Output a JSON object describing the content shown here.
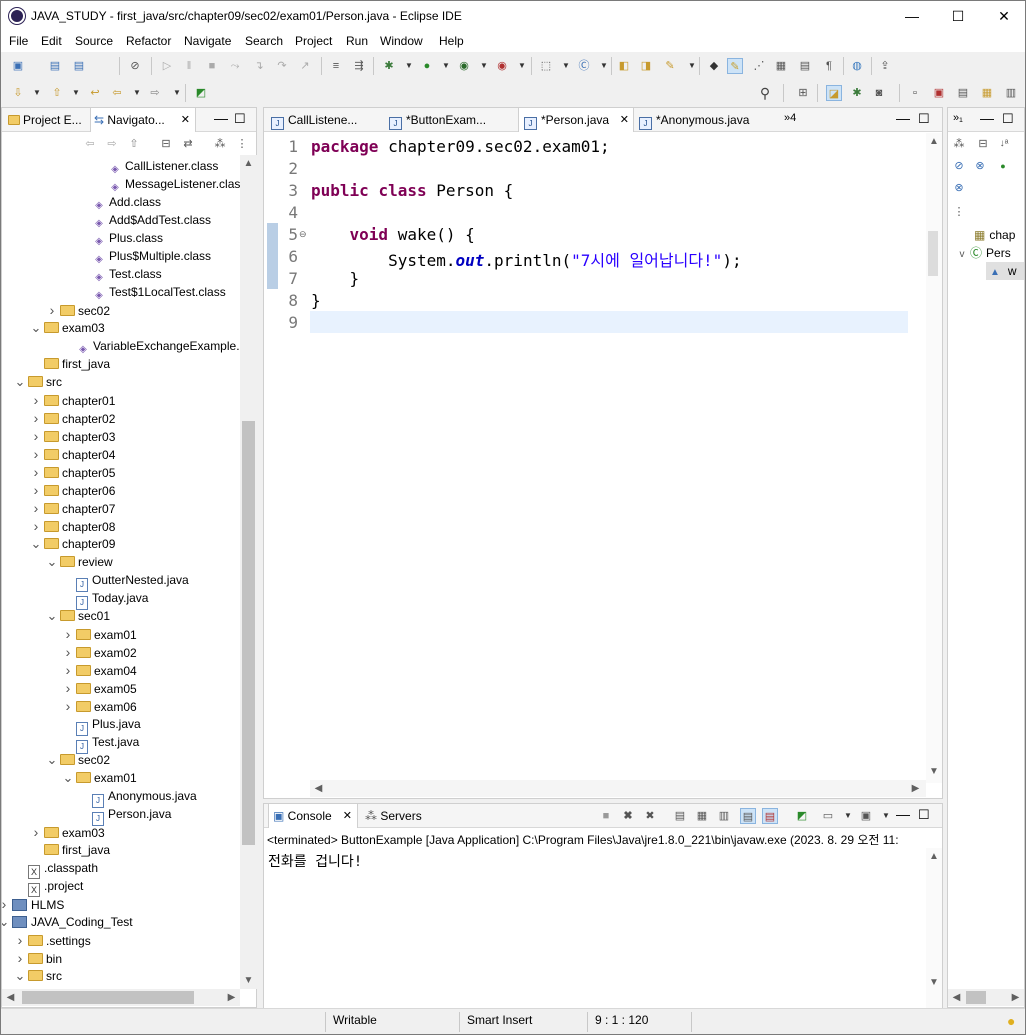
{
  "window": {
    "title": "JAVA_STUDY - first_java/src/chapter09/sec02/exam01/Person.java - Eclipse IDE",
    "minimize": "—",
    "maximize": "☐",
    "close": "✕"
  },
  "menu": [
    "File",
    "Edit",
    "Source",
    "Refactor",
    "Navigate",
    "Search",
    "Project",
    "Run",
    "Window",
    "Help"
  ],
  "explorer": {
    "tabs": [
      "Project E...",
      "Navigato..."
    ],
    "tree": [
      {
        "label": "CallListener.class",
        "indent": 108,
        "icon": "class-icon",
        "tw": ""
      },
      {
        "label": "MessageListener.class",
        "indent": 108,
        "icon": "class-icon",
        "tw": ""
      },
      {
        "label": "Add.class",
        "indent": 92,
        "icon": "class-icon",
        "tw": ""
      },
      {
        "label": "Add$AddTest.class",
        "indent": 92,
        "icon": "class-icon",
        "tw": ""
      },
      {
        "label": "Plus.class",
        "indent": 92,
        "icon": "class-icon",
        "tw": ""
      },
      {
        "label": "Plus$Multiple.class",
        "indent": 92,
        "icon": "class-icon",
        "tw": ""
      },
      {
        "label": "Test.class",
        "indent": 92,
        "icon": "class-icon",
        "tw": ""
      },
      {
        "label": "Test$1LocalTest.class",
        "indent": 92,
        "icon": "class-icon",
        "tw": ""
      },
      {
        "label": "sec02",
        "indent": 60,
        "icon": "folder-icon",
        "tw": ">"
      },
      {
        "label": "exam03",
        "indent": 44,
        "icon": "folder-icon",
        "tw": "v"
      },
      {
        "label": "VariableExchangeExample.c",
        "indent": 76,
        "icon": "class-icon",
        "tw": ""
      },
      {
        "label": "first_java",
        "indent": 44,
        "icon": "folder-icon",
        "tw": ""
      },
      {
        "label": "src",
        "indent": 28,
        "icon": "folder-icon",
        "tw": "v"
      },
      {
        "label": "chapter01",
        "indent": 44,
        "icon": "folder-icon",
        "tw": ">"
      },
      {
        "label": "chapter02",
        "indent": 44,
        "icon": "folder-icon",
        "tw": ">"
      },
      {
        "label": "chapter03",
        "indent": 44,
        "icon": "folder-icon",
        "tw": ">"
      },
      {
        "label": "chapter04",
        "indent": 44,
        "icon": "folder-icon",
        "tw": ">"
      },
      {
        "label": "chapter05",
        "indent": 44,
        "icon": "folder-icon",
        "tw": ">"
      },
      {
        "label": "chapter06",
        "indent": 44,
        "icon": "folder-icon",
        "tw": ">"
      },
      {
        "label": "chapter07",
        "indent": 44,
        "icon": "folder-icon",
        "tw": ">"
      },
      {
        "label": "chapter08",
        "indent": 44,
        "icon": "folder-icon",
        "tw": ">"
      },
      {
        "label": "chapter09",
        "indent": 44,
        "icon": "folder-icon",
        "tw": "v"
      },
      {
        "label": "review",
        "indent": 60,
        "icon": "folder-icon",
        "tw": "v"
      },
      {
        "label": "OutterNested.java",
        "indent": 76,
        "icon": "java-file-icon",
        "tw": ""
      },
      {
        "label": "Today.java",
        "indent": 76,
        "icon": "java-file-icon",
        "tw": ""
      },
      {
        "label": "sec01",
        "indent": 60,
        "icon": "folder-icon",
        "tw": "v"
      },
      {
        "label": "exam01",
        "indent": 76,
        "icon": "folder-icon",
        "tw": ">"
      },
      {
        "label": "exam02",
        "indent": 76,
        "icon": "folder-icon",
        "tw": ">"
      },
      {
        "label": "exam04",
        "indent": 76,
        "icon": "folder-icon",
        "tw": ">"
      },
      {
        "label": "exam05",
        "indent": 76,
        "icon": "folder-icon",
        "tw": ">"
      },
      {
        "label": "exam06",
        "indent": 76,
        "icon": "folder-icon",
        "tw": ">"
      },
      {
        "label": "Plus.java",
        "indent": 76,
        "icon": "java-file-icon",
        "tw": ""
      },
      {
        "label": "Test.java",
        "indent": 76,
        "icon": "java-file-icon",
        "tw": ""
      },
      {
        "label": "sec02",
        "indent": 60,
        "icon": "folder-icon",
        "tw": "v"
      },
      {
        "label": "exam01",
        "indent": 76,
        "icon": "folder-icon",
        "tw": "v"
      },
      {
        "label": "Anonymous.java",
        "indent": 92,
        "icon": "java-file-icon",
        "tw": ""
      },
      {
        "label": "Person.java",
        "indent": 92,
        "icon": "java-file-icon",
        "tw": ""
      },
      {
        "label": "exam03",
        "indent": 44,
        "icon": "folder-icon",
        "tw": ">"
      },
      {
        "label": "first_java",
        "indent": 44,
        "icon": "folder-icon",
        "tw": ""
      },
      {
        "label": ".classpath",
        "indent": 28,
        "icon": "xml-file-icon",
        "tw": ""
      },
      {
        "label": ".project",
        "indent": 28,
        "icon": "xml-file-icon",
        "tw": ""
      },
      {
        "label": "HLMS",
        "indent": 12,
        "icon": "project-icon",
        "tw": ">"
      },
      {
        "label": "JAVA_Coding_Test",
        "indent": 12,
        "icon": "project-icon",
        "tw": "v"
      },
      {
        "label": ".settings",
        "indent": 28,
        "icon": "folder-icon",
        "tw": ">"
      },
      {
        "label": "bin",
        "indent": 28,
        "icon": "folder-icon",
        "tw": ">"
      },
      {
        "label": "src",
        "indent": 28,
        "icon": "folder-icon",
        "tw": "v"
      }
    ]
  },
  "editor": {
    "tabs": [
      {
        "label": "CallListene...",
        "active": false,
        "close": ""
      },
      {
        "label": "*ButtonExam...",
        "active": false,
        "close": ""
      },
      {
        "label": "*Person.java",
        "active": true,
        "close": "✕"
      },
      {
        "label": "*Anonymous.java",
        "active": false,
        "close": ""
      }
    ],
    "overflow_count": "»4",
    "line_numbers": [
      "1",
      "2",
      "3",
      "4",
      "5",
      "6",
      "7",
      "8",
      "9"
    ],
    "code": {
      "l1_kw": "package",
      "l1_rest": " chapter09.sec02.exam01;",
      "l3_kw1": "public",
      "l3_sp": " ",
      "l3_kw2": "class",
      "l3_rest": " Person {",
      "l5_indent": "    ",
      "l5_kw": "void",
      "l5_rest": " wake() {",
      "l6_pre": "        System.",
      "l6_field": "out",
      "l6_mid": ".println(",
      "l6_str": "\"7시에 일어납니다!\"",
      "l6_end": ");",
      "l7": "    }",
      "l8": "}"
    }
  },
  "outline": {
    "items": [
      "chap",
      "Pers",
      "w"
    ]
  },
  "console": {
    "tabs": [
      "Console",
      "Servers"
    ],
    "header": "<terminated> ButtonExample [Java Application] C:\\Program Files\\Java\\jre1.8.0_221\\bin\\javaw.exe  (2023. 8. 29 오전 11:",
    "output": "전화를 겁니다!"
  },
  "status": {
    "writable": "Writable",
    "insert_mode": "Smart Insert",
    "position": "9 : 1 : 120"
  }
}
